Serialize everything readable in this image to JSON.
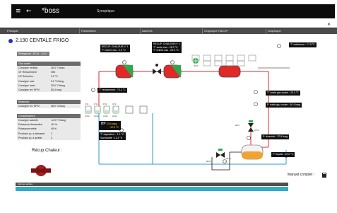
{
  "app": {
    "brand": "boss",
    "title": "Synoptique"
  },
  "nav": {
    "tabs": [
      "Principal",
      "Paramètres",
      "Alarmes",
      "Graphique HACCP",
      "Graphique"
    ]
  },
  "page": {
    "title": "2.190 CENTALE FRIGO",
    "refrigerant": "Réfrigérant : R744 - CO2"
  },
  "panels": {
    "gas_cooler": {
      "header": "Gas cooler",
      "rows": [
        {
          "label": "Consigne ventilat.",
          "value": "28.3 °C/bars"
        },
        {
          "label": "GT Refoulement",
          "value": "098"
        },
        {
          "label": "HP Refoulem.",
          "value": "3.0 °C"
        },
        {
          "label": "Consigne max",
          "value": "5.0 °C/barg"
        },
        {
          "label": "Consigne maxi.",
          "value": "25.0 °C/barg"
        },
        {
          "label": "Consigne ref. HPIV",
          "value": "60.4 barg"
        }
      ]
    },
    "reservoir": {
      "header": "Réservoir",
      "rows": [
        {
          "label": "Consigne ref. RPIV",
          "value": "38.0 °C/barg"
        }
      ]
    },
    "compressors": {
      "header": "Compresseurs",
      "rows": [
        {
          "label": "Consigne actuelle",
          "value": "-13.0 °C/barg"
        },
        {
          "label": "Puissance demandée",
          "value": "-84 %"
        },
        {
          "label": "Puissance réelle",
          "value": "45 %"
        },
        {
          "label": "Prochain cp. à démarrer",
          "value": "2"
        },
        {
          "label": "Prochain cp. à arrêter",
          "value": "4"
        }
      ]
    }
  },
  "schema": {
    "desup1": {
      "title": "RECUP. CHALEUR n° 1",
      "l1": "T° entrée eau : 0.0 °C"
    },
    "desup2": {
      "title": "RECUP. CHALEUR n° 2",
      "l1": "T° sortie eau : 28.3 °C",
      "l2": "T° entrée eau : 22.3 °C"
    },
    "temp_exterieure": "T° extérieure : 17.5 °C",
    "t_refoulement": "T° refoulement : 73.2 °C",
    "t_sortie_gas_cooler": "T° sortie gaz cooler : 20.0 °C",
    "p_sortie_gas_cooler": "P. sortie gaz cooler : 60.4 barg",
    "p_reservoir": "P. réservoir : 37.8 barg",
    "t_liquide": "T° liquide : 20.0 °C",
    "bp_pressure": "23.6 barg",
    "bp_temp": "-12.5 °C",
    "t_aspiration": "T° aspiration : -1.1 °C",
    "surchauffe": "Surchauffe : 11.4 °K",
    "hpv": "HPV",
    "rpiv": "RPIV",
    "pct_fan": "40 %",
    "pct_hpv": "18 %",
    "pct_rpiv": "36 %",
    "comp_pct": [
      "0 %",
      "0 %",
      "0 %",
      "0 %"
    ],
    "comp_state": [
      "Arrêt",
      "Arrêt",
      "Arrêt",
      "Arrêt"
    ],
    "bp": "BP"
  },
  "recup": {
    "label": "Récup Chaleur :"
  },
  "manual": {
    "label": "Manuel complet :"
  },
  "alarms": {
    "header": "Alarmes actives"
  }
}
